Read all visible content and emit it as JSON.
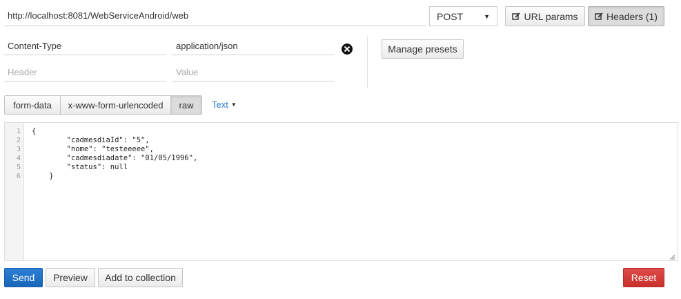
{
  "request": {
    "url": "http://localhost:8081/WebServiceAndroid/web",
    "method": "POST"
  },
  "toolbar": {
    "url_params_label": "URL params",
    "headers_label": "Headers (1)"
  },
  "headers": {
    "rows": [
      {
        "key": "Content-Type",
        "value": "application/json"
      }
    ],
    "new_key_placeholder": "Header",
    "new_value_placeholder": "Value",
    "manage_presets_label": "Manage presets"
  },
  "body": {
    "tabs": [
      {
        "label": "form-data",
        "active": false
      },
      {
        "label": "x-www-form-urlencoded",
        "active": false
      },
      {
        "label": "raw",
        "active": true
      }
    ],
    "format_label": "Text",
    "line_numbers": "1\n2\n3\n4\n5\n6",
    "code": "{\n        \"cadmesdiaId\": \"5\",\n        \"nome\": \"testeeeee\",\n        \"cadmesdiadate\": \"01/05/1996\",\n        \"status\": null\n    }"
  },
  "actions": {
    "send_label": "Send",
    "preview_label": "Preview",
    "add_collection_label": "Add to collection",
    "reset_label": "Reset"
  },
  "colors": {
    "link_blue": "#2a7ad1",
    "send_blue": "#1f72c8",
    "reset_red": "#d43f3a"
  },
  "icons": {
    "url_params": "edit-square-icon",
    "headers": "edit-square-icon",
    "remove_header": "close-circle-icon"
  }
}
